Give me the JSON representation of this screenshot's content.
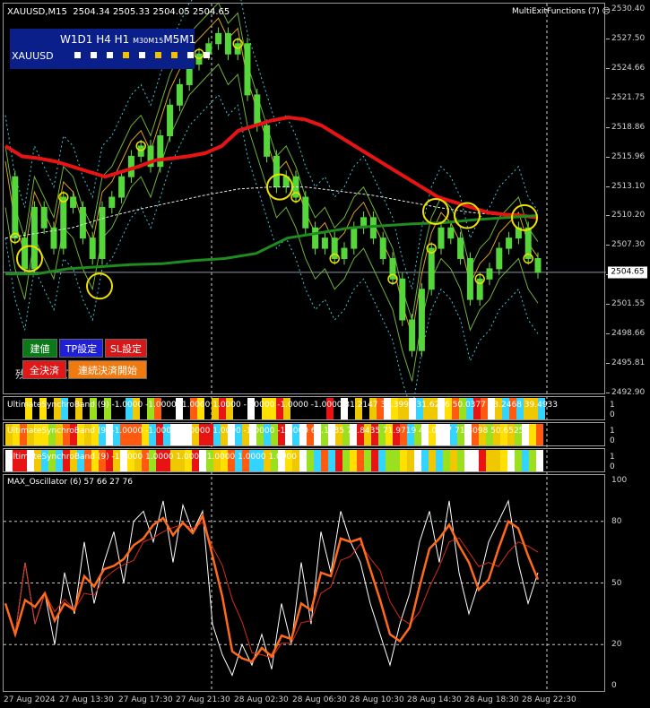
{
  "chart_header": {
    "symbol_tf": "XAUUSD,M15",
    "ohlc": "2504.34 2505.33 2504.05 2504.65"
  },
  "multiexit_label": "MultiExitFunctions (7)",
  "timeframe_panel": {
    "tf_main": "W1D1 H4 H1",
    "tf_small": "M30M15",
    "tf_tail": "M5M1",
    "symbol": "XAUUSD",
    "square_colors": [
      "#ffffff",
      "#ffffff",
      "#ffffff",
      "#f2c200",
      "#ffffff",
      "#f2c200",
      "#f2c200",
      "#ffffff",
      "#ffffff"
    ]
  },
  "buttons": {
    "entry": "建値",
    "tp": "TP設定",
    "sl": "SL設定",
    "close_all": "全決済",
    "continuous_close": "連続決済開始",
    "partial_text": "残り多ナビ"
  },
  "price_axis": {
    "ticks": [
      "2530.40",
      "2527.50",
      "2524.66",
      "2521.75",
      "2518.86",
      "2515.96",
      "2513.10",
      "2510.20",
      "2507.30",
      "2504.41",
      "2501.55",
      "2498.66",
      "2495.81",
      "2492.90"
    ],
    "current_price": "2504.65"
  },
  "bands": [
    {
      "title": "UltimateSynchroBand (9) -1.0000 -1.0000 -1.0000 1.0000 -1.0000 -1.0000 -1.0000 31.2147 37.3995 31.6216 50.0377 33.2468 39.4933",
      "scale": [
        "1",
        "0"
      ]
    },
    {
      "title": "UltimateSynchroBand (9) -1.0000 -1.0000 -1.0000 1.0000 -1.0000 -1.0000 62.1485 75.8435 71.9719 44.0317 71.3098 50.6525",
      "scale": [
        "1",
        "0"
      ]
    },
    {
      "title": "UltimateSynchroBand (9) -1.0000 1.0000 1.0000 1.0000 1.0000 1.0000",
      "scale": [
        "1",
        "0"
      ]
    }
  ],
  "oscillator": {
    "title": "MAX_Oscillator (6) 57 66 27 76",
    "ticks": [
      "100",
      "80",
      "50",
      "20",
      "0"
    ]
  },
  "time_axis": [
    "27 Aug 2024",
    "27 Aug 13:30",
    "27 Aug 17:30",
    "27 Aug 21:30",
    "28 Aug 02:30",
    "28 Aug 06:30",
    "28 Aug 10:30",
    "28 Aug 14:30",
    "28 Aug 18:30",
    "28 Aug 22:30"
  ],
  "chart_data": {
    "type": "line",
    "title": "XAUUSD,M15",
    "ylim": [
      2492.9,
      2530.4
    ],
    "close_series": [
      2514,
      2508,
      2505,
      2511,
      2509,
      2507,
      2512,
      2511,
      2508,
      2506,
      2511,
      2512,
      2514,
      2516,
      2517,
      2515,
      2518,
      2521,
      2523,
      2525,
      2526,
      2527,
      2528,
      2526,
      2527,
      2522,
      2519,
      2516,
      2513,
      2514,
      2512,
      2509,
      2507,
      2508,
      2506,
      2507,
      2509,
      2510,
      2508,
      2506,
      2504,
      2500,
      2497,
      2503,
      2507,
      2509,
      2508,
      2506,
      2502,
      2504,
      2505,
      2507,
      2508,
      2509,
      2506,
      2504.65
    ],
    "red_ma": [
      2517,
      2516,
      2515.8,
      2515.5,
      2515,
      2514.5,
      2514,
      2514.5,
      2515,
      2515.6,
      2515.8,
      2516,
      2516.3,
      2517,
      2518.5,
      2519,
      2519.5,
      2519.8,
      2519.6,
      2519,
      2518,
      2517,
      2516,
      2515,
      2514,
      2513,
      2512,
      2511.5,
      2511,
      2510.5,
      2510.3,
      2510.2,
      2510
    ],
    "green_ma": [
      2504.5,
      2504.5,
      2505,
      2505.2,
      2505.4,
      2505.5,
      2505.8,
      2506,
      2506.5,
      2508,
      2508.5,
      2509,
      2509.2,
      2509.4,
      2509.5,
      2509.8,
      2510,
      2510.2
    ]
  }
}
